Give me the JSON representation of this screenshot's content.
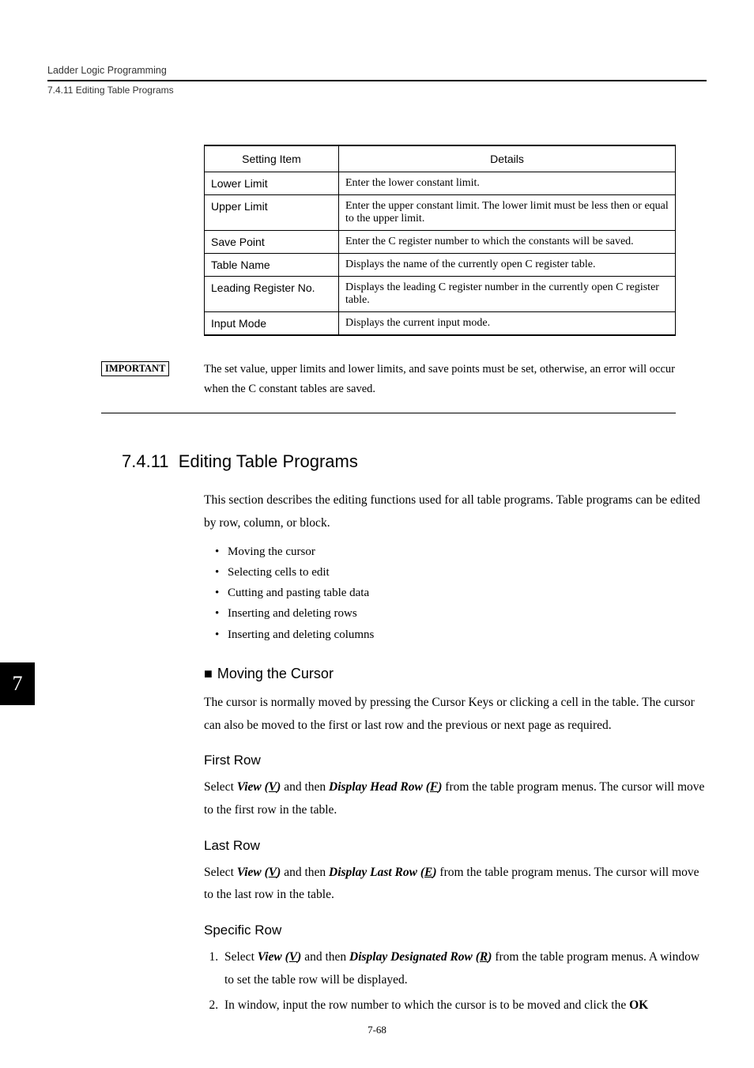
{
  "header": {
    "running_title": "Ladder Logic Programming",
    "running_sub": "7.4.11  Editing Table Programs"
  },
  "table": {
    "head": {
      "c1": "Setting Item",
      "c2": "Details"
    },
    "rows": [
      {
        "item": "Lower Limit",
        "details": "Enter the lower constant limit."
      },
      {
        "item": "Upper Limit",
        "details": "Enter the upper constant limit. The lower limit must be less then or equal to the upper limit."
      },
      {
        "item": "Save Point",
        "details": "Enter the C register number to which the constants will be saved."
      },
      {
        "item": "Table Name",
        "details": "Displays the name of the currently open C register table."
      },
      {
        "item": "Leading Register No.",
        "details": "Displays the leading C register number in the currently open C register table."
      },
      {
        "item": "Input Mode",
        "details": "Displays the current input mode."
      }
    ]
  },
  "important": {
    "label": "IMPORTANT",
    "text_a": "The set value, upper limits and lower limits, and save points must be set, otherwise, an error will occur when the C ",
    "text_b": "constant",
    "text_c": " tables are saved."
  },
  "section": {
    "number": "7.4.11",
    "title": "Editing Table Programs",
    "intro": "This section describes the editing functions used for all table programs. Table programs can be edited by row, column, or block.",
    "bullets": [
      "Moving the cursor",
      "Selecting cells to edit",
      "Cutting and pasting table data",
      "Inserting and deleting rows",
      "Inserting and deleting columns"
    ]
  },
  "moving": {
    "heading": "Moving the Cursor",
    "para": "The cursor is normally moved by pressing the Cursor Keys or clicking a cell in the table. The cursor can also be moved to the first or last row and the previous or next page as required."
  },
  "first_row": {
    "heading": "First Row",
    "t0": "Select ",
    "view": "View (",
    "v": "V",
    "view_close": ")",
    "t1": " and then ",
    "disp": "Display Head Row (",
    "f": "F",
    "disp_close": ")",
    "t2": " from the table program menus. The cursor will move to the first row in the table."
  },
  "last_row": {
    "heading": "Last Row",
    "t0": "Select ",
    "view": "View (",
    "v": "V",
    "view_close": ")",
    "t1": " and then ",
    "disp": "Display Last Row (",
    "e": "E",
    "disp_close": ")",
    "t2": " from the table program menus. The cursor will move to the last row in the table."
  },
  "specific_row": {
    "heading": "Specific Row",
    "step1_a": "Select ",
    "step1_view": "View (",
    "step1_v": "V",
    "step1_view_close": ")",
    "step1_b": " and then ",
    "step1_disp": "Display Designated Row (",
    "step1_r": "R",
    "step1_disp_close": ")",
    "step1_c": " from the table program menus. A window to set the table row will be displayed.",
    "step2_a": "In window, input the row number to which the cursor is to be moved and click the ",
    "step2_ok": "OK"
  },
  "chapter_tab": "7",
  "page_number": "7-68"
}
